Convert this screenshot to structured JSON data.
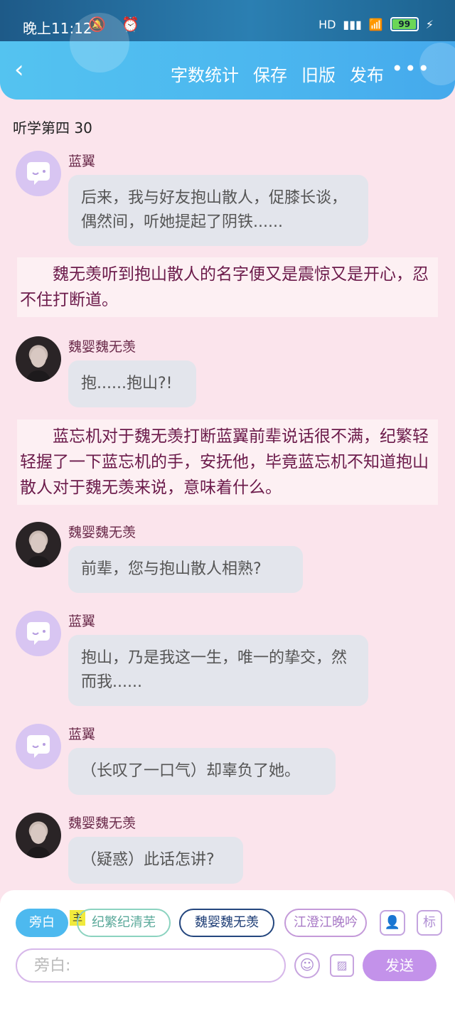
{
  "status_bar": {
    "time": "晚上11:12",
    "icons": [
      "mute-bell-icon",
      "alarm-icon"
    ],
    "network": "HD",
    "battery": "99"
  },
  "nav": {
    "back_icon": "chevron-left-icon",
    "actions": [
      "字数统计",
      "保存",
      "旧版",
      "发布"
    ],
    "more": "•••"
  },
  "chapter_title": "听学第四 30",
  "messages": [
    {
      "type": "chat",
      "avatar": "chat-bubble-bot-icon",
      "sender": "蓝翼",
      "text": "后来，我与好友抱山散人，促膝长谈，偶然间，听她提起了阴铁......"
    },
    {
      "type": "narration",
      "text": "魏无羡听到抱山散人的名字便又是震惊又是开心，忍不住打断道。"
    },
    {
      "type": "chat",
      "avatar": "person-portrait",
      "sender": "魏婴魏无羡",
      "text": "抱......抱山?!"
    },
    {
      "type": "narration",
      "text": "蓝忘机对于魏无羡打断蓝翼前辈说话很不满，纪繁轻轻握了一下蓝忘机的手，安抚他，毕竟蓝忘机不知道抱山散人对于魏无羡来说，意味着什么。"
    },
    {
      "type": "chat",
      "avatar": "person-portrait",
      "sender": "魏婴魏无羡",
      "text": "前辈，您与抱山散人相熟?"
    },
    {
      "type": "chat",
      "avatar": "chat-bubble-bot-icon",
      "sender": "蓝翼",
      "text": "抱山，乃是我这一生，唯一的挚交，然而我......"
    },
    {
      "type": "chat",
      "avatar": "chat-bubble-bot-icon",
      "sender": "蓝翼",
      "text": "（长叹了一口气）却辜负了她。"
    },
    {
      "type": "chat",
      "avatar": "person-portrait",
      "sender": "魏婴魏无羡",
      "text": "（疑惑）此话怎讲?"
    }
  ],
  "roles": {
    "narrator": "旁白",
    "main_badge": "主",
    "jifan": "纪繁纪清芜",
    "wei": "魏婴魏无羡",
    "jiang": "江澄江晚吟"
  },
  "tools": {
    "add_role_icon": "add-person-icon",
    "mark_label": "标"
  },
  "input": {
    "placeholder": "旁白:",
    "value": ""
  },
  "send_label": "发送"
}
